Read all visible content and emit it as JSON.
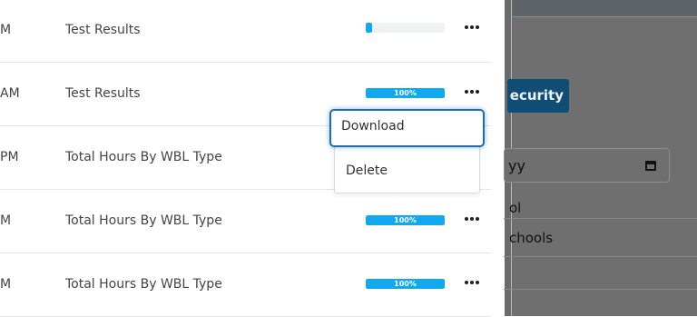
{
  "rows": [
    {
      "time": "M",
      "name": "Test Results",
      "progress_label": "",
      "progress_percent": 0
    },
    {
      "time": "AM",
      "name": "Test Results",
      "progress_label": "100%",
      "progress_percent": 100
    },
    {
      "time": "PM",
      "name": "Total Hours By WBL Type",
      "progress_label": "",
      "progress_percent": 0
    },
    {
      "time": "M",
      "name": "Total Hours By WBL Type",
      "progress_label": "100%",
      "progress_percent": 100
    },
    {
      "time": "M",
      "name": "Total Hours By WBL Type",
      "progress_label": "100%",
      "progress_percent": 100
    }
  ],
  "menu": {
    "download_label": "Download",
    "delete_label": "Delete"
  },
  "right_panel": {
    "button_label": "ecurity",
    "date_value": "yy",
    "list_item_1": "ol",
    "list_item_2": "chools"
  },
  "colors": {
    "progress_fill": "#12a8f0",
    "menu_focus": "#1c6fa8",
    "security_button": "#124d76"
  }
}
